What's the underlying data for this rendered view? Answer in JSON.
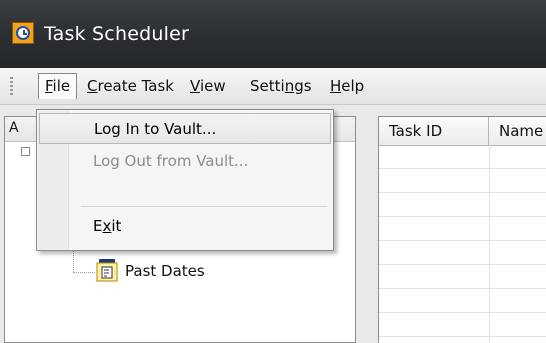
{
  "window": {
    "title": "Task Scheduler"
  },
  "menubar": {
    "items": [
      {
        "label": "File",
        "ul": "F",
        "rest": "ile"
      },
      {
        "label": "Create Task",
        "ul": "C",
        "rest": "reate Task"
      },
      {
        "label": "View",
        "ul": "V",
        "rest": "iew"
      },
      {
        "label": "Settings",
        "pre": "Setti",
        "ul": "n",
        "rest": "gs"
      },
      {
        "label": "Help",
        "ul": "H",
        "rest": "elp"
      }
    ]
  },
  "file_menu": {
    "items": [
      {
        "label": "Log In to Vault...",
        "state": "highlighted"
      },
      {
        "label": "Log Out from Vault...",
        "state": "disabled"
      },
      {
        "label": "Exit",
        "pre": "E",
        "ul": "x",
        "rest": "it",
        "state": "normal"
      }
    ]
  },
  "left_panel": {
    "header_initial": "A",
    "tree": {
      "node_label": "Past Dates"
    }
  },
  "grid": {
    "columns": [
      "Task ID",
      "Name"
    ]
  }
}
